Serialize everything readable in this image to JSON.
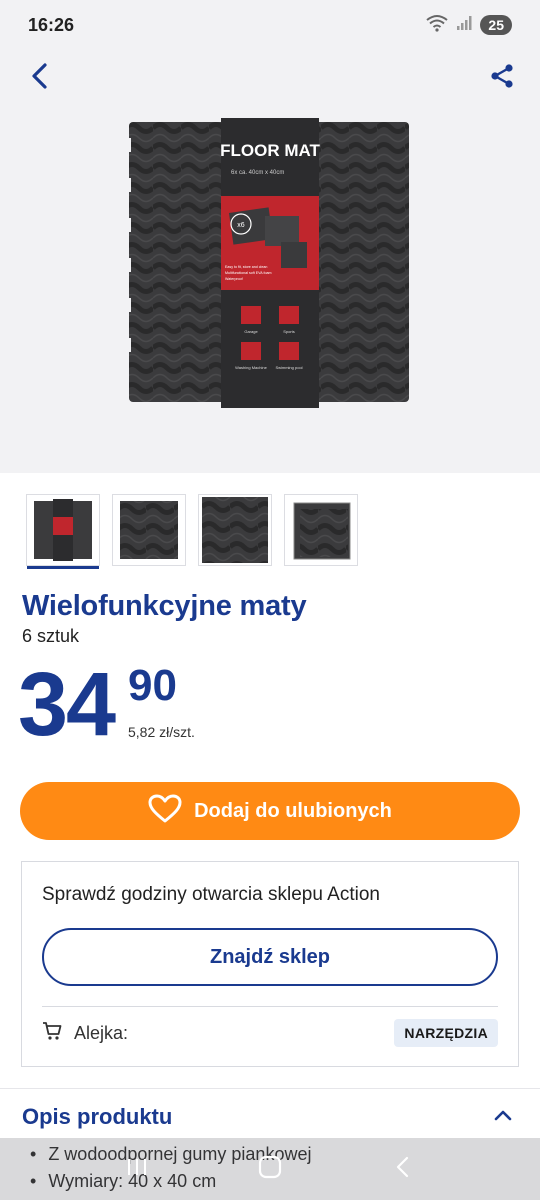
{
  "status": {
    "time": "16:26",
    "battery": "25"
  },
  "product": {
    "box_heading": "FLOOR MAT",
    "box_size": "6x ca. 40cm x 40cm",
    "box_count": "x6",
    "box_features": [
      "Easy to fit, store and clean",
      "Multifunctional soft EVA foam",
      "Waterproof"
    ],
    "box_uses": [
      "Garage",
      "Sports",
      "Washing Machine",
      "Swimming pool"
    ],
    "name": "Wielofunkcyjne maty",
    "quantity": "6 sztuk",
    "price_whole": "34",
    "price_cents": "90",
    "unit_price": "5,82 zł/szt."
  },
  "thumbnails": {
    "count": 4,
    "active_index": 0
  },
  "actions": {
    "favorite_label": "Dodaj do ulubionych"
  },
  "store": {
    "prompt": "Sprawdź godziny otwarcia sklepu Action",
    "find_label": "Znajdź sklep",
    "aisle_label": "Alejka:",
    "aisle_value": "NARZĘDZIA"
  },
  "description": {
    "title": "Opis produktu",
    "bullets": [
      "Z wodoodpornej gumy piankowej",
      "Wymiary: 40 x 40 cm"
    ]
  },
  "colors": {
    "brand_blue": "#1a3a8f",
    "orange": "#ff8a14",
    "badge_bg": "#e6edf7"
  }
}
